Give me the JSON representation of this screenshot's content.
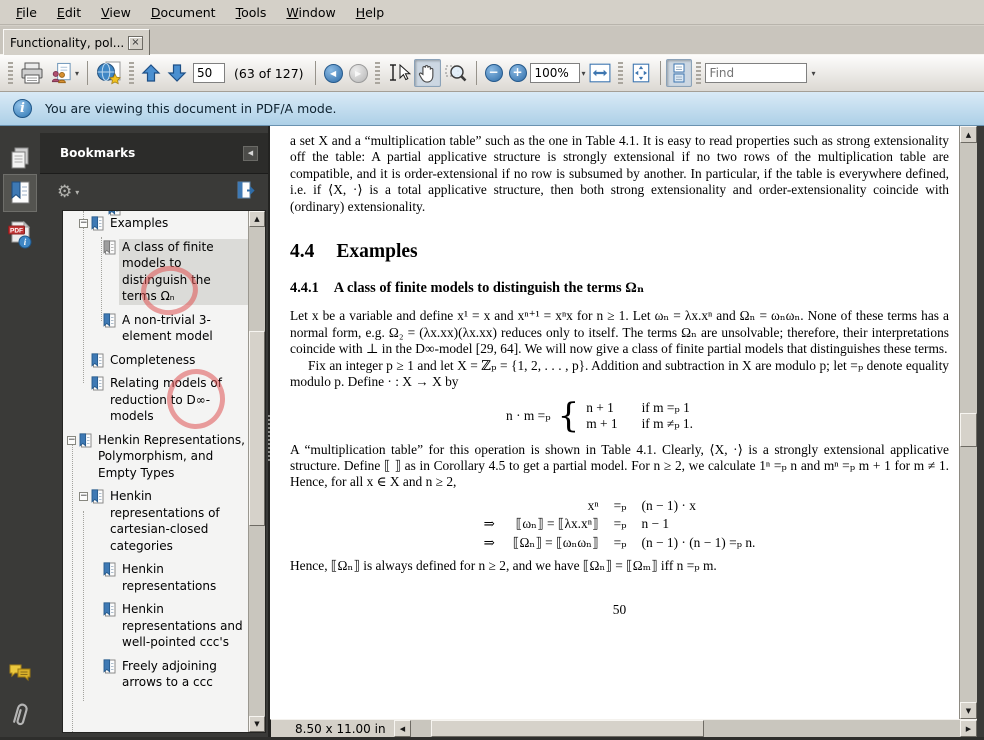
{
  "window": {
    "tab_title": "Functionality, pol..."
  },
  "menu": {
    "items": [
      {
        "key": "F",
        "rest": "ile"
      },
      {
        "key": "E",
        "rest": "dit"
      },
      {
        "key": "V",
        "rest": "iew"
      },
      {
        "key": "D",
        "rest": "ocument"
      },
      {
        "key": "T",
        "rest": "ools"
      },
      {
        "key": "W",
        "rest": "indow"
      },
      {
        "key": "H",
        "rest": "elp"
      }
    ]
  },
  "toolbar": {
    "page_value": "50",
    "page_count": "(63 of 127)",
    "zoom_value": "100%",
    "find_placeholder": "Find"
  },
  "notice": {
    "text": "You are viewing this document in PDF/A mode."
  },
  "bookmarks": {
    "title": "Bookmarks",
    "items": [
      {
        "label": "Examples",
        "level": 2,
        "expanded": true,
        "selected": false
      },
      {
        "label": "A class of finite models to distinguish the terms Ωₙ",
        "level": 3,
        "selected": true
      },
      {
        "label": "A non-trivial 3-element model",
        "level": 3,
        "selected": false
      },
      {
        "label": "Completeness",
        "level": 2,
        "selected": false
      },
      {
        "label": "Relating models of reduction to D∞-models",
        "level": 2,
        "selected": false
      },
      {
        "label": "Henkin Representations, Polymorphism, and Empty Types",
        "level": 1,
        "expanded": true,
        "selected": false
      },
      {
        "label": "Henkin representations of cartesian-closed categories",
        "level": 2,
        "expanded": true,
        "selected": false
      },
      {
        "label": "Henkin representations",
        "level": 3,
        "selected": false
      },
      {
        "label": "Henkin representations and well-pointed ccc's",
        "level": 3,
        "selected": false
      },
      {
        "label": "Freely adjoining arrows to a ccc",
        "level": 3,
        "selected": false
      }
    ]
  },
  "document": {
    "para1": "a set X and a “multiplication table” such as the one in Table 4.1. It is easy to read properties such as strong extensionality off the table: A partial applicative structure is strongly extensional if no two rows of the multiplication table are compatible, and it is order-extensional if no row is subsumed by another. In particular, if the table is everywhere defined, i.e. if ⟨X, ·⟩ is a total applicative structure, then both strong extensionality and order-extensionality coincide with (ordinary) extensionality.",
    "h1_num": "4.4",
    "h1_title": "Examples",
    "h2_num": "4.4.1",
    "h2_title": "A class of finite models to distinguish the terms Ωₙ",
    "para2": "Let x be a variable and define x¹ = x and xⁿ⁺¹ = xⁿx for n ≥ 1. Let ωₙ = λx.xⁿ and Ωₙ = ωₙωₙ. None of these terms has a normal form, e.g. Ω₂ = (λx.xx)(λx.xx) reduces only to itself. The terms Ωₙ are unsolvable; therefore, their interpretations coincide with ⊥ in the D∞-model [29, 64]. We will now give a class of finite partial models that distinguishes these terms.",
    "para3": "Fix an integer p ≥ 1 and let X = ℤₚ = {1, 2, . . . , p}. Addition and subtraction in X are modulo p; let =ₚ denote equality modulo p. Define · : X → X by",
    "cases": {
      "lhs": "n · m =ₚ",
      "brace": "{",
      "rows": [
        [
          "n + 1",
          "if m =ₚ 1"
        ],
        [
          "m + 1",
          "if m ≠ₚ 1."
        ]
      ]
    },
    "para4": "A “multiplication table” for this operation is shown in Table 4.1. Clearly, ⟨X, ·⟩ is a strongly extensional applicative structure. Define ⟦ ⟧ as in Corollary 4.5 to get a partial model. For n ≥ 2, we calculate 1ⁿ =ₚ n and mⁿ =ₚ m + 1 for m ≠ 1. Hence, for all x ∈ X and n ≥ 2,",
    "equations": {
      "rows": [
        {
          "arrow": "",
          "lhs": "xⁿ",
          "rel": "=ₚ",
          "rhs": "(n − 1) · x"
        },
        {
          "arrow": "⇒",
          "lhs": "⟦ωₙ⟧ = ⟦λx.xⁿ⟧",
          "rel": "=ₚ",
          "rhs": "n − 1"
        },
        {
          "arrow": "⇒",
          "lhs": "⟦Ωₙ⟧ = ⟦ωₙωₙ⟧",
          "rel": "=ₚ",
          "rhs": "(n − 1) · (n − 1) =ₚ n."
        }
      ]
    },
    "para5": "Hence, ⟦Ωₙ⟧ is always defined for n ≥ 2, and we have ⟦Ωₙ⟧ = ⟦Ωₘ⟧ iff n =ₚ m.",
    "page_number": "50"
  },
  "statusbar": {
    "page_size": "8.50 x 11.00 in"
  },
  "icons": {
    "close_tab": "×",
    "dropdown_caret": "▾",
    "gear": "⚙",
    "panel_collapse": "◀",
    "info": "i",
    "pdf_label": "PDF",
    "scroll_up": "▲",
    "scroll_down": "▼",
    "scroll_left": "◀",
    "scroll_right": "▶",
    "nav_back": "◀",
    "nav_forward": "▶",
    "zoom_out": "−",
    "zoom_in": "+",
    "expander_minus": "−",
    "select_ibeam": "I"
  },
  "colors": {
    "accent_blue": "#3e79b4",
    "notice_bg": "#bcd8ec",
    "selection_bg": "#dbdbd8",
    "annotation_red": "#df5252",
    "panel_bg": "#3a3a38",
    "chrome_gray": "#d4d0c8"
  }
}
